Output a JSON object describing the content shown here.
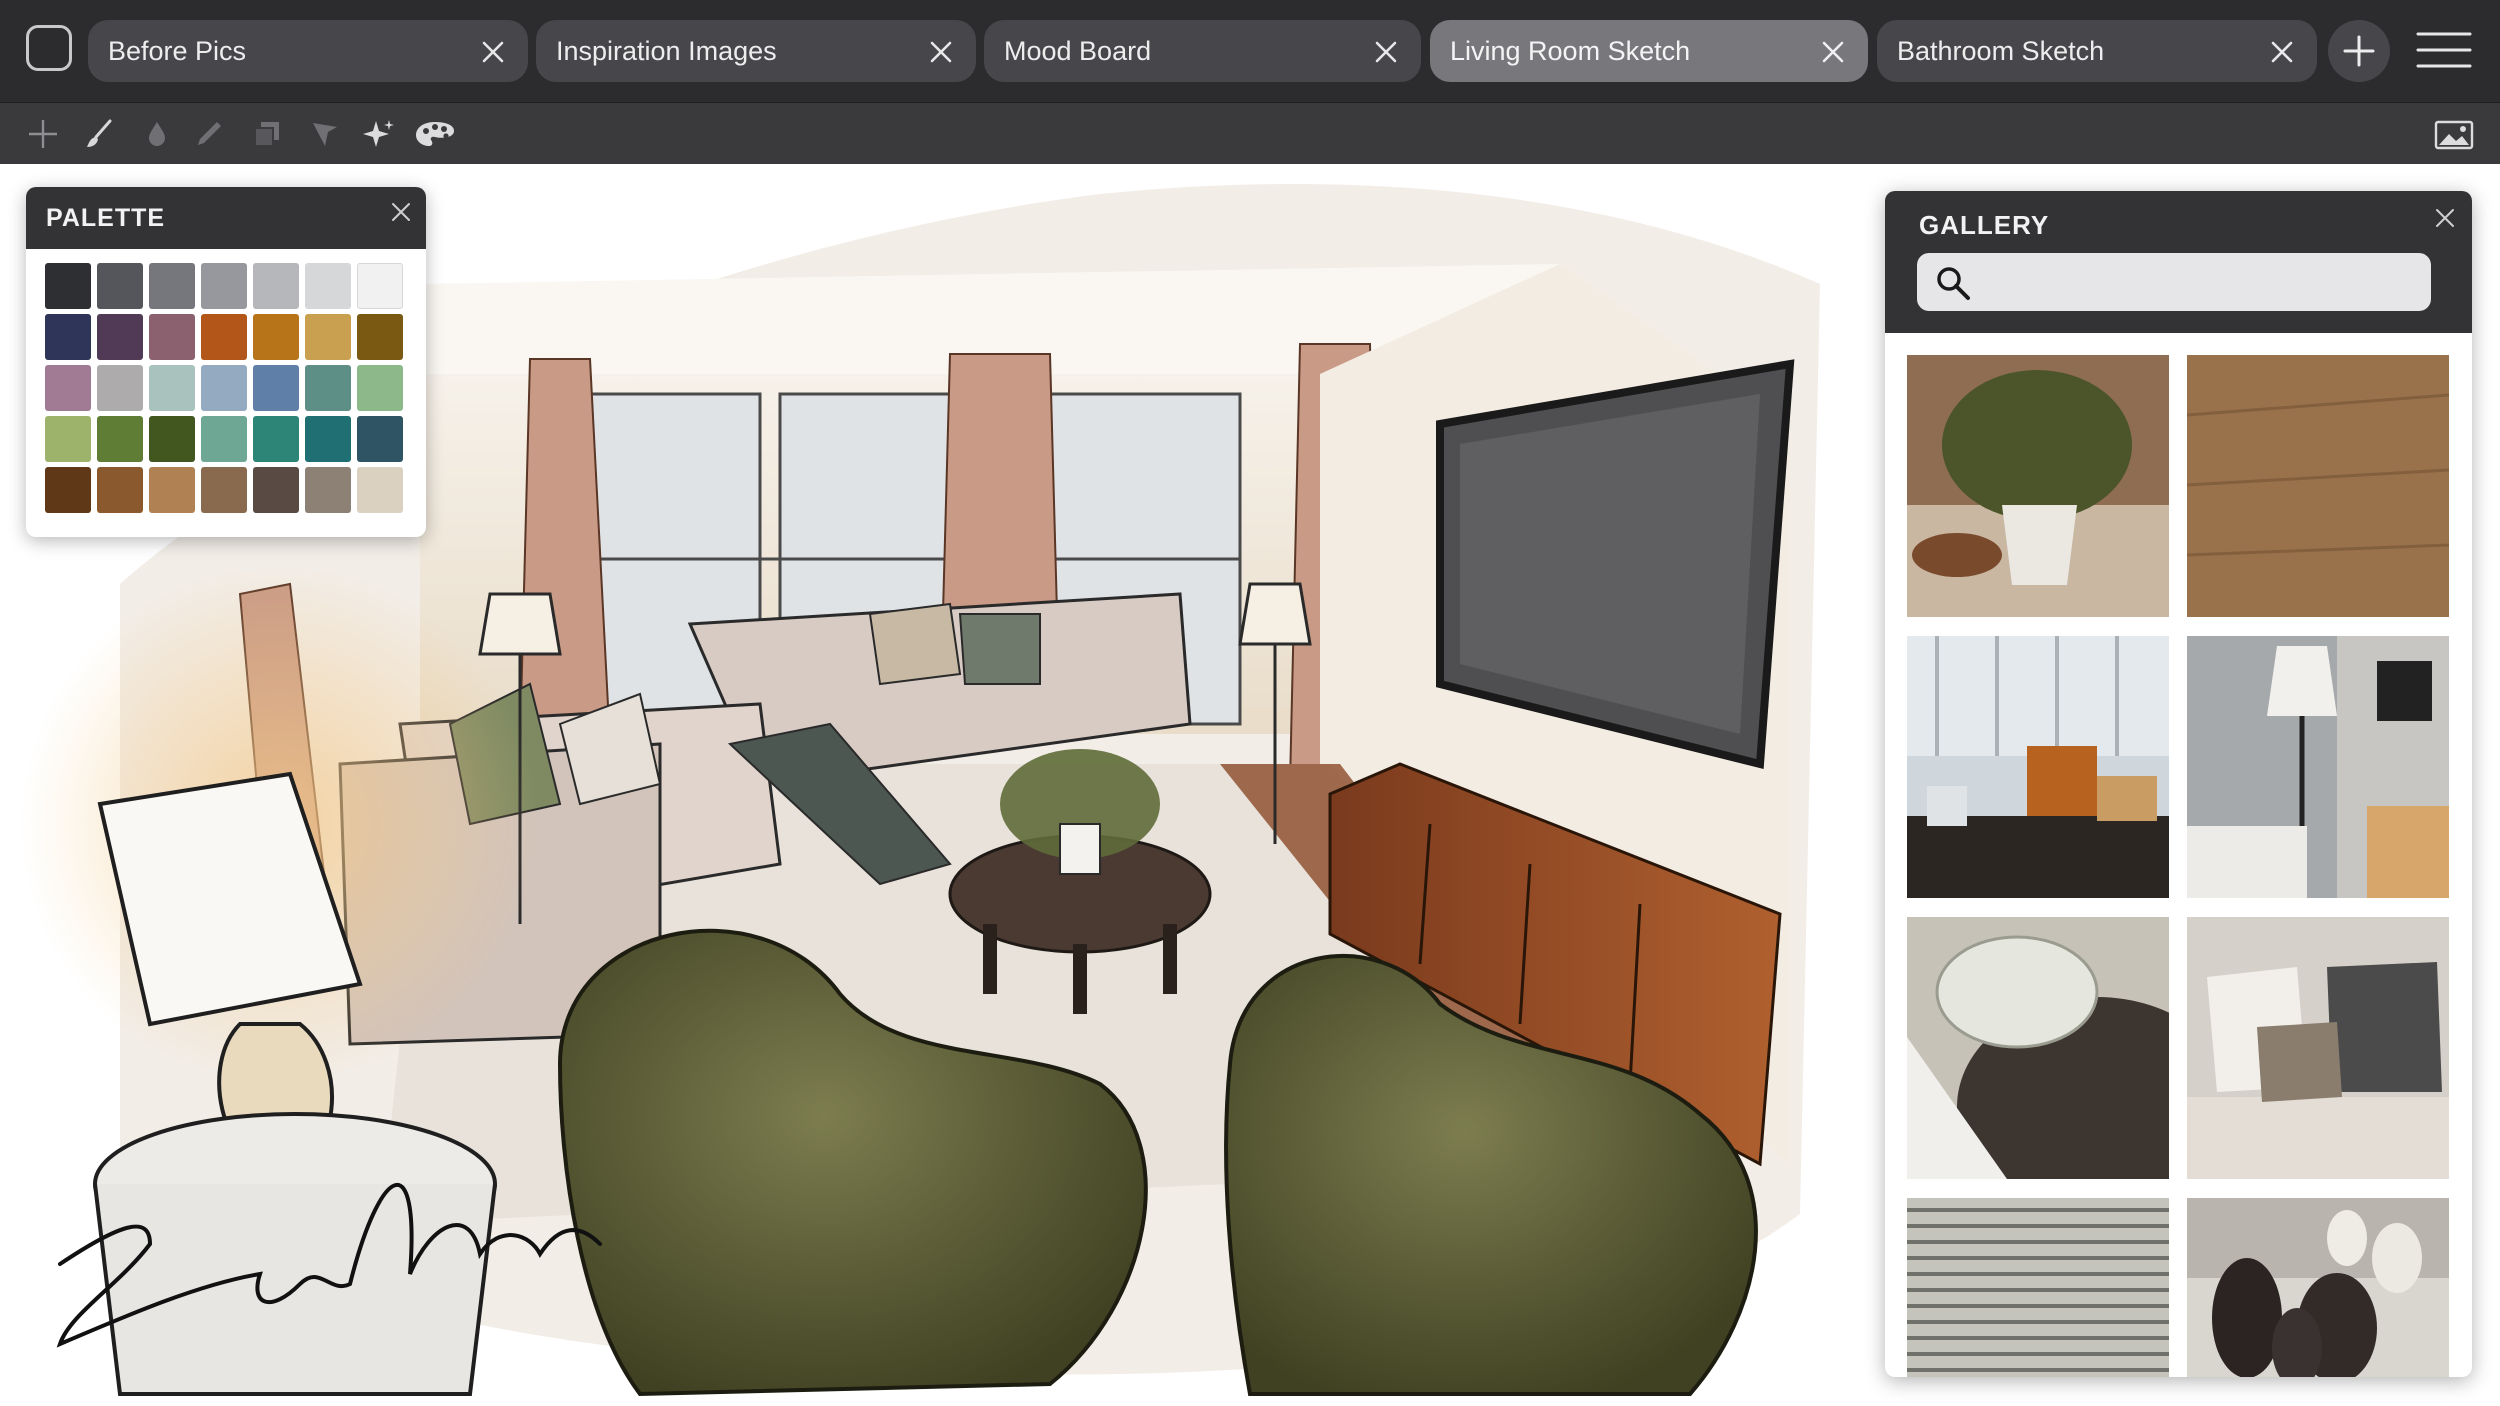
{
  "tabs": [
    {
      "label": "Before Pics",
      "active": false
    },
    {
      "label": "Inspiration Images",
      "active": false
    },
    {
      "label": "Mood Board",
      "active": false
    },
    {
      "label": "Living Room Sketch",
      "active": true
    },
    {
      "label": "Bathroom Sketch",
      "active": false
    }
  ],
  "toolbar": {
    "tools": [
      "crosshair-icon",
      "brush-icon",
      "ink-drop-icon",
      "pencil-icon",
      "layers-icon",
      "selection-arrow-icon",
      "sparkle-icon",
      "palette-icon"
    ],
    "right_tool": "image-icon"
  },
  "palette": {
    "title": "PALETTE",
    "swatches": [
      [
        "#2e2f33",
        "#55565b",
        "#76777c",
        "#97989d",
        "#b6b7bb",
        "#d6d7d9",
        "#f1f1f2"
      ],
      [
        "#2f3559",
        "#513a55",
        "#8b6170",
        "#b3561a",
        "#b87419",
        "#c9a04f",
        "#7a5a12"
      ],
      [
        "#a07b93",
        "#adabab",
        "#a9c2bd",
        "#93aac0",
        "#5f7ea8",
        "#5e8f86",
        "#8db889"
      ],
      [
        "#9db36c",
        "#5f7d35",
        "#42561f",
        "#6ea895",
        "#2d8578",
        "#1f6f73",
        "#2f5464"
      ],
      [
        "#5f3818",
        "#8a5a2e",
        "#b08152",
        "#8a6a4f",
        "#5a4a44",
        "#8c8174",
        "#dbd1c0"
      ]
    ]
  },
  "gallery": {
    "title": "GALLERY",
    "search_placeholder": "",
    "thumbnails": [
      "potted-plant-photo",
      "wood-floor-photo",
      "toy-shelf-photo",
      "floor-lamp-photo",
      "plates-table-photo",
      "sofa-pillows-photo",
      "striped-fabric-photo",
      "vases-photo"
    ]
  },
  "sketch": {
    "description_icon": "living-room-sketch"
  },
  "colors": {
    "tabbar_bg": "#2c2c2e",
    "tab_bg": "#47474b",
    "tab_active_bg": "#77777c",
    "toolbar_bg": "#3a3a3d",
    "panel_header": "#333336"
  }
}
